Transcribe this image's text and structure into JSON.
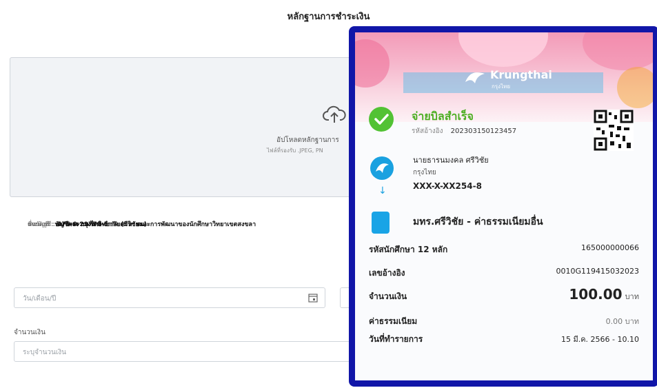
{
  "page": {
    "title": "หลักฐานการชำระเงิน"
  },
  "upload": {
    "text": "อัปโหลดหลักฐานการ",
    "hint": "ไฟล์ที่รองรับ .JPEG, PN"
  },
  "info": {
    "rows": [
      {
        "label": "ธนาคาร :",
        "value": "ธนาคาร กรุงไทย จำกัด (มหาชน)"
      },
      {
        "label": "เลขบัญชี :",
        "value": "475-0-29770-5"
      },
      {
        "label": "ชื่อบัญชี :",
        "value": "บัญชีผลงานมหาวิทยาลัยศรีวิชัยและการพัฒนาของนักศึกษาวิทยาเขตสงขลา"
      }
    ]
  },
  "form": {
    "date_placeholder": "วัน/เดือน/ปี",
    "amount_label": "จำนวนเงิน",
    "amount_placeholder": "ระบุจำนวนเงิน"
  },
  "receipt": {
    "bank_name": "Krungthai",
    "bank_sub": "กรุงไทย",
    "status": "จ่ายบิลสำเร็จ",
    "ref_label": "รหัสอ้างอิง",
    "ref_value": "202303150123457",
    "from_name": "นายธารนมงคล ศรีวิชัย",
    "from_bank": "กรุงไทย",
    "from_account": "XXX-X-XX254-8",
    "to_name": "มทร.ศรีวิชัย - ค่าธรรมเนียมอื่น",
    "rows": [
      {
        "label": "รหัสนักศึกษา 12 หลัก",
        "value": "165000000066"
      },
      {
        "label": "เลขอ้างอิง",
        "value": "0010G119415032023"
      },
      {
        "label": "จำนวนเงิน",
        "value": "100.00",
        "unit": "บาท"
      },
      {
        "label": "ค่าธรรมเนียม",
        "value": "0.00 บาท"
      },
      {
        "label": "วันที่ทำรายการ",
        "value": "15 มี.ค. 2566 - 10.10"
      }
    ]
  },
  "colors": {
    "card_border": "#1116a8",
    "success": "#52c234",
    "bank_blue": "#1aa1e0"
  }
}
